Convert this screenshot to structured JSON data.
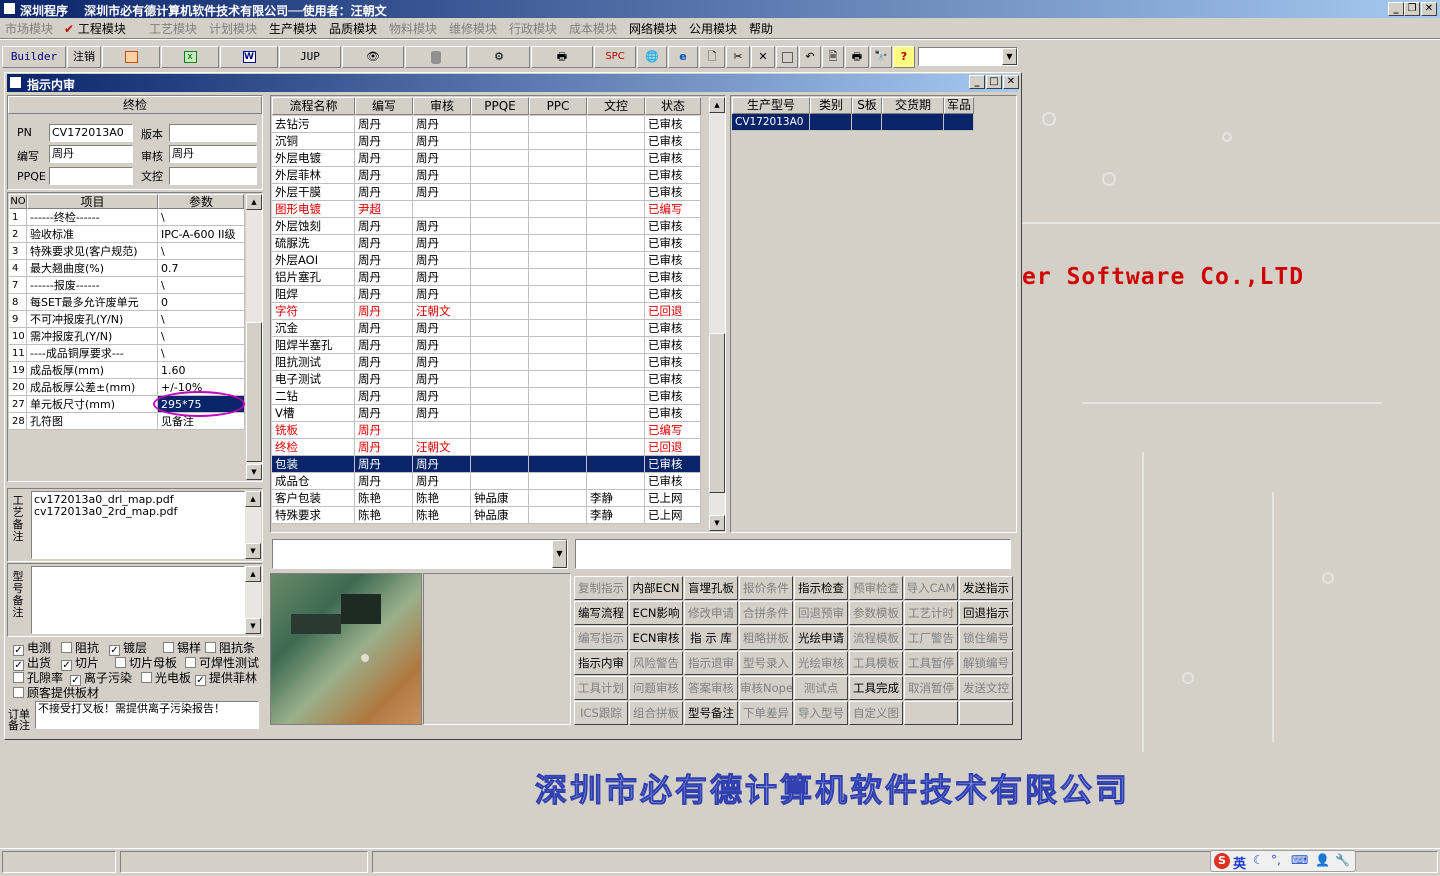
{
  "app": {
    "title": "深圳程序　 深圳市必有德计算机软件技术有限公司──使用者：汪朝文"
  },
  "menu": [
    {
      "label": "市场模块",
      "enabled": false
    },
    {
      "label": "工程模块",
      "enabled": true,
      "checked": true
    },
    {
      "label": "工艺模块",
      "enabled": false
    },
    {
      "label": "计划模块",
      "enabled": false
    },
    {
      "label": "生产模块",
      "enabled": true
    },
    {
      "label": "品质模块",
      "enabled": true
    },
    {
      "label": "物料模块",
      "enabled": false
    },
    {
      "label": "维修模块",
      "enabled": false
    },
    {
      "label": "行政模块",
      "enabled": false
    },
    {
      "label": "成本模块",
      "enabled": false
    },
    {
      "label": "网络模块",
      "enabled": true
    },
    {
      "label": "公用模块",
      "enabled": true
    },
    {
      "label": "帮助",
      "enabled": true
    }
  ],
  "toolbar": {
    "builder": "Builder",
    "logout": "注销",
    "jup": "JUP",
    "spc": "SPC",
    "help": "?",
    "icons": [
      "powerpoint-icon",
      "excel-icon",
      "word-icon",
      "eye-icon",
      "database-icon",
      "network-icon",
      "printer-device-icon",
      "globe-icon",
      "ie-icon",
      "new-document-icon",
      "cut-icon",
      "delete-icon",
      "save-icon",
      "undo-icon",
      "preview-icon",
      "print-icon",
      "find-icon"
    ]
  },
  "window": {
    "title": "指示内审"
  },
  "left": {
    "step": "终检",
    "pn_label": "PN",
    "pn_value": "CV172013A0",
    "version_label": "版本",
    "version_value": "",
    "editor_label": "编写",
    "editor_value": "周丹",
    "review_label": "审核",
    "review_value": "周丹",
    "ppqe_label": "PPQE",
    "ppqe_value": "",
    "wenkong_label": "文控",
    "wenkong_value": "",
    "params_headers": [
      "NO",
      "项目",
      "参数"
    ],
    "params": [
      {
        "no": "1",
        "item": "------终检------",
        "value": "\\"
      },
      {
        "no": "2",
        "item": "验收标准",
        "value": "IPC-A-600 II级"
      },
      {
        "no": "3",
        "item": "特殊要求见(客户规范)",
        "value": "\\"
      },
      {
        "no": "4",
        "item": "最大翘曲度(%)",
        "value": "0.7"
      },
      {
        "no": "7",
        "item": "------报废------",
        "value": "\\"
      },
      {
        "no": "8",
        "item": "每SET最多允许废单元",
        "value": "0"
      },
      {
        "no": "9",
        "item": "不可冲报废孔(Y/N)",
        "value": "\\"
      },
      {
        "no": "10",
        "item": "需冲报废孔(Y/N)",
        "value": "\\"
      },
      {
        "no": "11",
        "item": "----成品铜厚要求---",
        "value": "\\"
      },
      {
        "no": "19",
        "item": "成品板厚(mm)",
        "value": "1.60"
      },
      {
        "no": "20",
        "item": "成品板厚公差±(mm)",
        "value": "+/-10%"
      },
      {
        "no": "27",
        "item": "单元板尺寸(mm)",
        "value": "295*75",
        "selected": true
      },
      {
        "no": "28",
        "item": "孔符图",
        "value": "见备注"
      }
    ],
    "process_note_label": "工艺备注",
    "process_notes": [
      "cv172013a0_drl_map.pdf",
      "cv172013a0_2rd_map.pdf"
    ],
    "model_note_label": "型号备注",
    "model_note": "",
    "checkboxes": [
      {
        "label": "电测",
        "checked": true
      },
      {
        "label": "阻抗",
        "checked": false
      },
      {
        "label": "镀层",
        "checked": true
      },
      {
        "label": "锡样",
        "checked": false
      },
      {
        "label": "阻抗条",
        "checked": false
      },
      {
        "label": "出货",
        "checked": true
      },
      {
        "label": "切片",
        "checked": true
      },
      {
        "label": "切片母板",
        "checked": false
      },
      {
        "label": "可焊性测试",
        "checked": false
      },
      {
        "label": "孔隙率",
        "checked": false
      },
      {
        "label": "离子污染",
        "checked": true
      },
      {
        "label": "光电板",
        "checked": false
      },
      {
        "label": "提供菲林",
        "checked": true
      },
      {
        "label": "顾客提供板材",
        "checked": false
      }
    ],
    "order_note_label": "订单备注",
    "order_note": "不接受打叉板！需提供离子污染报告！"
  },
  "flow": {
    "headers": [
      "流程名称",
      "编写",
      "审核",
      "PPQE",
      "PPC",
      "文控",
      "状态"
    ],
    "rows": [
      {
        "name": "去钻污",
        "editor": "周丹",
        "reviewer": "周丹",
        "ppqe": "",
        "ppc": "",
        "wenkong": "",
        "status": "已审核"
      },
      {
        "name": "沉铜",
        "editor": "周丹",
        "reviewer": "周丹",
        "ppqe": "",
        "ppc": "",
        "wenkong": "",
        "status": "已审核"
      },
      {
        "name": "外层电镀",
        "editor": "周丹",
        "reviewer": "周丹",
        "ppqe": "",
        "ppc": "",
        "wenkong": "",
        "status": "已审核"
      },
      {
        "name": "外层菲林",
        "editor": "周丹",
        "reviewer": "周丹",
        "ppqe": "",
        "ppc": "",
        "wenkong": "",
        "status": "已审核"
      },
      {
        "name": "外层干膜",
        "editor": "周丹",
        "reviewer": "周丹",
        "ppqe": "",
        "ppc": "",
        "wenkong": "",
        "status": "已审核"
      },
      {
        "name": "图形电镀",
        "editor": "尹超",
        "reviewer": "",
        "ppqe": "",
        "ppc": "",
        "wenkong": "",
        "status": "已编写",
        "red": true
      },
      {
        "name": "外层蚀刻",
        "editor": "周丹",
        "reviewer": "周丹",
        "ppqe": "",
        "ppc": "",
        "wenkong": "",
        "status": "已审核"
      },
      {
        "name": "硫脲洗",
        "editor": "周丹",
        "reviewer": "周丹",
        "ppqe": "",
        "ppc": "",
        "wenkong": "",
        "status": "已审核"
      },
      {
        "name": "外层AOI",
        "editor": "周丹",
        "reviewer": "周丹",
        "ppqe": "",
        "ppc": "",
        "wenkong": "",
        "status": "已审核"
      },
      {
        "name": "铝片塞孔",
        "editor": "周丹",
        "reviewer": "周丹",
        "ppqe": "",
        "ppc": "",
        "wenkong": "",
        "status": "已审核"
      },
      {
        "name": "阻焊",
        "editor": "周丹",
        "reviewer": "周丹",
        "ppqe": "",
        "ppc": "",
        "wenkong": "",
        "status": "已审核"
      },
      {
        "name": "字符",
        "editor": "周丹",
        "reviewer": "汪朝文",
        "ppqe": "",
        "ppc": "",
        "wenkong": "",
        "status": "已回退",
        "red": true
      },
      {
        "name": "沉金",
        "editor": "周丹",
        "reviewer": "周丹",
        "ppqe": "",
        "ppc": "",
        "wenkong": "",
        "status": "已审核"
      },
      {
        "name": "阻焊半塞孔",
        "editor": "周丹",
        "reviewer": "周丹",
        "ppqe": "",
        "ppc": "",
        "wenkong": "",
        "status": "已审核"
      },
      {
        "name": "阻抗测试",
        "editor": "周丹",
        "reviewer": "周丹",
        "ppqe": "",
        "ppc": "",
        "wenkong": "",
        "status": "已审核"
      },
      {
        "name": "电子测试",
        "editor": "周丹",
        "reviewer": "周丹",
        "ppqe": "",
        "ppc": "",
        "wenkong": "",
        "status": "已审核"
      },
      {
        "name": "二钻",
        "editor": "周丹",
        "reviewer": "周丹",
        "ppqe": "",
        "ppc": "",
        "wenkong": "",
        "status": "已审核"
      },
      {
        "name": "V槽",
        "editor": "周丹",
        "reviewer": "周丹",
        "ppqe": "",
        "ppc": "",
        "wenkong": "",
        "status": "已审核"
      },
      {
        "name": "铣板",
        "editor": "周丹",
        "reviewer": "",
        "ppqe": "",
        "ppc": "",
        "wenkong": "",
        "status": "已编写",
        "red": true
      },
      {
        "name": "终检",
        "editor": "周丹",
        "reviewer": "汪朝文",
        "ppqe": "",
        "ppc": "",
        "wenkong": "",
        "status": "已回退",
        "red": true
      },
      {
        "name": "包装",
        "editor": "周丹",
        "reviewer": "周丹",
        "ppqe": "",
        "ppc": "",
        "wenkong": "",
        "status": "已审核",
        "selected": true
      },
      {
        "name": "成品仓",
        "editor": "周丹",
        "reviewer": "周丹",
        "ppqe": "",
        "ppc": "",
        "wenkong": "",
        "status": "已审核"
      },
      {
        "name": "客户包装",
        "editor": "陈艳",
        "reviewer": "陈艳",
        "ppqe": "钟品康",
        "ppc": "",
        "wenkong": "李静",
        "status": "已上网"
      },
      {
        "name": "特殊要求",
        "editor": "陈艳",
        "reviewer": "陈艳",
        "ppqe": "钟品康",
        "ppc": "",
        "wenkong": "李静",
        "status": "已上网"
      }
    ]
  },
  "production": {
    "headers": [
      "生产型号",
      "类别",
      "S板",
      "交货期",
      "军品"
    ],
    "rows": [
      {
        "model": "CV172013A0",
        "category": "",
        "s_board": "",
        "delivery": "",
        "military": ""
      }
    ]
  },
  "actions": [
    [
      "复制指示",
      "内部ECN",
      "盲埋孔板",
      "报价条件",
      "指示检查",
      "预审检查",
      "导入CAM",
      "发送指示"
    ],
    [
      "编写流程",
      "ECN影响",
      "修改申请",
      "合拼条件",
      "回退预审",
      "参数模板",
      "工艺计时",
      "回退指示"
    ],
    [
      "编写指示",
      "ECN审核",
      "指 示 库",
      "粗略拼板",
      "光绘申请",
      "流程模板",
      "工厂警告",
      "锁住编号"
    ],
    [
      "指示内审",
      "风险警告",
      "指示退审",
      "型号录入",
      "光绘审核",
      "工具模板",
      "工具暂停",
      "解锁编号"
    ],
    [
      "工具计划",
      "问题审核",
      "答案审核",
      "审核Nope",
      "测试点",
      "工具完成",
      "取消暂停",
      "发送文控"
    ],
    [
      "ICS跟踪",
      "组合拼板",
      "型号备注",
      "下单差异",
      "导入型号",
      "自定义图",
      "",
      ""
    ]
  ],
  "actions_enabled": [
    [
      false,
      true,
      true,
      false,
      true,
      false,
      false,
      true
    ],
    [
      true,
      true,
      false,
      false,
      false,
      false,
      false,
      true
    ],
    [
      false,
      true,
      true,
      false,
      true,
      false,
      false,
      false
    ],
    [
      true,
      false,
      false,
      false,
      false,
      false,
      false,
      false
    ],
    [
      false,
      false,
      false,
      false,
      false,
      true,
      false,
      false
    ],
    [
      false,
      false,
      true,
      false,
      false,
      false,
      false,
      false
    ]
  ],
  "watermark": {
    "en": "er Software Co.,LTD",
    "cn": "深圳市必有德计算机软件技术有限公司"
  },
  "ime": {
    "lang": "英"
  },
  "colors": {
    "title_start": "#0a246a",
    "title_end": "#a6caf0",
    "select_bg": "#0a246a",
    "red_text": "#e00000",
    "face": "#d4d0c8",
    "annotation_ellipse": "#c000c0"
  }
}
